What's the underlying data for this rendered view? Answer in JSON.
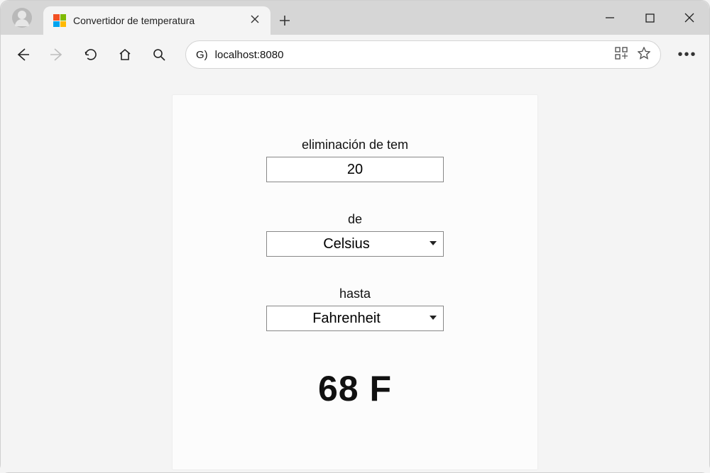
{
  "browser": {
    "tab_title": "Convertidor de temperatura",
    "address_prefix": "G)",
    "address_url": "localhost:8080"
  },
  "form": {
    "input_label": "eliminación de tem",
    "input_value": "20",
    "from_label": "de",
    "from_value": "Celsius",
    "to_label": "hasta",
    "to_value": "Fahrenheit"
  },
  "result_text": "68 F"
}
